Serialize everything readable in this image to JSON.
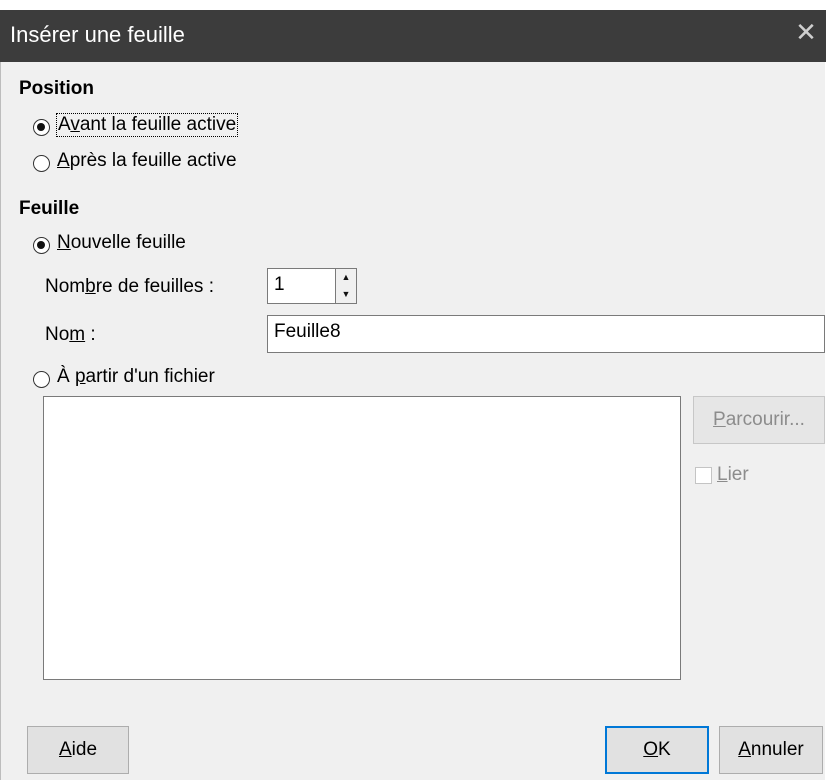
{
  "window": {
    "title": "Insérer une feuille",
    "close_glyph": "✕"
  },
  "position": {
    "heading": "Position",
    "before": {
      "label_pre": "A",
      "label_ul": "v",
      "label_post": "ant la feuille active",
      "checked": true
    },
    "after": {
      "label_pre": "",
      "label_ul": "A",
      "label_post": "près la feuille active",
      "checked": false
    }
  },
  "sheet": {
    "heading": "Feuille",
    "new_sheet": {
      "label_pre": "",
      "label_ul": "N",
      "label_post": "ouvelle feuille",
      "checked": true
    },
    "count": {
      "label_pre": "Nom",
      "label_ul": "b",
      "label_post": "re de feuilles :",
      "value": "1"
    },
    "name": {
      "label_pre": "No",
      "label_ul": "m",
      "label_post": " :",
      "value": "Feuille8"
    },
    "from_file": {
      "label_pre": "À ",
      "label_ul": "p",
      "label_post": "artir d'un fichier",
      "checked": false
    },
    "browse": {
      "label_ul": "P",
      "label_post": "arcourir..."
    },
    "link": {
      "label_ul": "L",
      "label_post": "ier",
      "checked": false
    }
  },
  "buttons": {
    "help": {
      "label_ul": "A",
      "label_post": "ide"
    },
    "ok": {
      "label_ul": "O",
      "label_post": "K"
    },
    "cancel": {
      "label_ul": "A",
      "label_post": "nnuler"
    }
  },
  "icons": {
    "spin_up": "▲",
    "spin_down": "▼"
  },
  "colors": {
    "titlebar": "#3c3c3c",
    "dialog_bg": "#f0f0f0",
    "default_button_border": "#0078d7"
  }
}
